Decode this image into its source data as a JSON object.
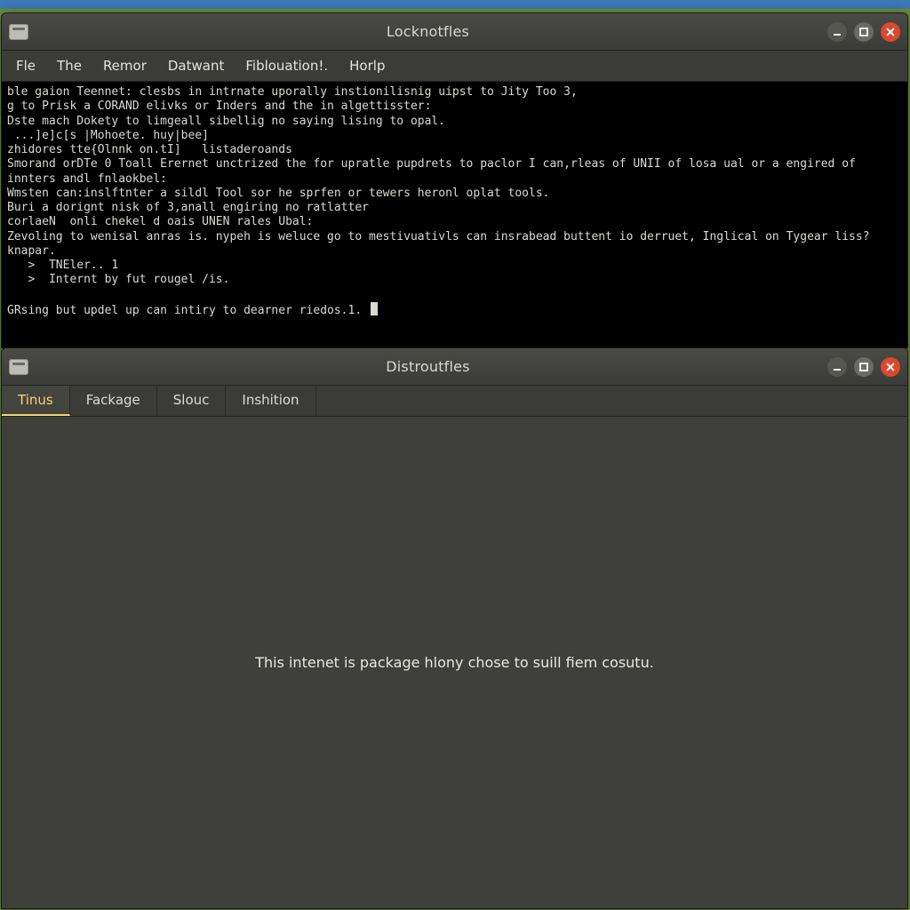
{
  "terminal_window": {
    "title": "Locknotfles",
    "menu": [
      "Fle",
      "The",
      "Remor",
      "Datwant",
      "Fiblouation!.",
      "Horlp"
    ],
    "lines": [
      "ble gaion Teennet: clesbs in intrnate uporally instionilisnig uipst to Jity Too 3,",
      "g to Prisk a CORAND elivks or Inders and the in algettisster:",
      "Dste mach Dokety to limgeall sibellig no saying lising to opal.",
      " ...]e]c[s |Mohoete. huy|bee]",
      "zhidores tte{Olnnk on.tI]   listaderoands",
      "Smorand orDTe 0 Toall Erernet unctrized the for upratle pupdrets to paclor I can,rleas of UNII of losa ual or a engired of",
      "innters andl fnlaokbel:",
      "Wmsten can:inslftnter a sildl Tool sor he sprfen or tewers heronl oplat tools.",
      "Buri a dorignt nisk of 3,anall engiring no ratlatter",
      "corlaeN  onli chekel d oais UNEN rales Ubal:",
      "Zevoling to wenisal anras is. nypeh is weluce go to mestivuativls can insrabead buttent io derruet, Inglical on Tygear liss?",
      "knapar.",
      "   >  TNEler.. 1",
      "   >  Internt by fut rougel /is.",
      "",
      "GRsing but updel up can intiry to dearner riedos.1. "
    ]
  },
  "distro_window": {
    "title": "Distroutfles",
    "tabs": [
      {
        "label": "Tinus",
        "active": true
      },
      {
        "label": "Fackage",
        "active": false
      },
      {
        "label": "Slouc",
        "active": false
      },
      {
        "label": "Inshition",
        "active": false
      }
    ],
    "message": "This intenet is package hlony chose to suill fiem cosutu."
  }
}
